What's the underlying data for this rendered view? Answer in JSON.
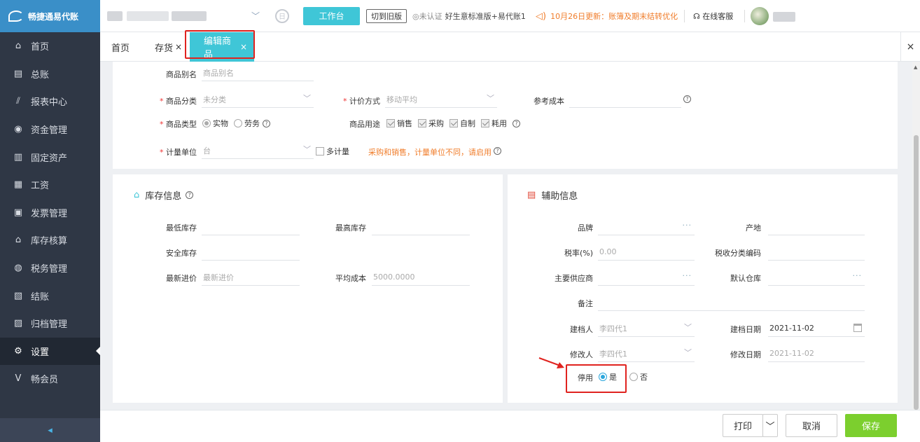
{
  "app": {
    "logo_text": "畅捷通易代账",
    "account_name_blur": ""
  },
  "sidebar": {
    "items": [
      {
        "label": "首页",
        "icon": "⌂"
      },
      {
        "label": "总账",
        "icon": "▤"
      },
      {
        "label": "报表中心",
        "icon": "⫽"
      },
      {
        "label": "资金管理",
        "icon": "◉"
      },
      {
        "label": "固定资产",
        "icon": "▥"
      },
      {
        "label": "工资",
        "icon": "▦"
      },
      {
        "label": "发票管理",
        "icon": "▣"
      },
      {
        "label": "库存核算",
        "icon": "⌂"
      },
      {
        "label": "税务管理",
        "icon": "◍"
      },
      {
        "label": "结账",
        "icon": "▧"
      },
      {
        "label": "归档管理",
        "icon": "▨"
      },
      {
        "label": "设置",
        "icon": "⚙"
      },
      {
        "label": "畅会员",
        "icon": "V"
      }
    ],
    "active_index": 11,
    "collapse_icon": "◂"
  },
  "topbar": {
    "workbench": "工作台",
    "switch_old": "切到旧版",
    "cert": "◎未认证",
    "plan": "好生意标准版+易代账1",
    "notice": "10月26日更新：账簿及期末结转优化",
    "service": "在线客服"
  },
  "tabs": [
    {
      "label": "首页",
      "closable": false
    },
    {
      "label": "存货",
      "closable": true
    },
    {
      "label": "编辑商品",
      "closable": true,
      "active": true
    }
  ],
  "tab_close": "×",
  "basic": {
    "alias_label": "商品别名",
    "alias_placeholder": "商品别名",
    "category_label": "商品分类",
    "category_value": "未分类",
    "pricing_label": "计价方式",
    "pricing_value": "移动平均",
    "ref_cost_label": "参考成本",
    "type_label": "商品类型",
    "type_options": [
      "实物",
      "劳务"
    ],
    "usage_label": "商品用途",
    "usage_options": [
      "销售",
      "采购",
      "自制",
      "耗用"
    ],
    "unit_label": "计量单位",
    "unit_value": "台",
    "multi_unit": "多计量",
    "unit_hint": "采购和销售，计量单位不同，请启用"
  },
  "inventory": {
    "title": "库存信息",
    "min_label": "最低库存",
    "max_label": "最高库存",
    "safe_label": "安全库存",
    "last_price_label": "最新进价",
    "last_price_placeholder": "最新进价",
    "avg_cost_label": "平均成本",
    "avg_cost_value": "5000.0000"
  },
  "aux": {
    "title": "辅助信息",
    "brand_label": "品牌",
    "origin_label": "产地",
    "tax_label": "税率(%)",
    "tax_value": "0.00",
    "tax_code_label": "税收分类编码",
    "supplier_label": "主要供应商",
    "warehouse_label": "默认仓库",
    "remark_label": "备注",
    "creator_label": "建档人",
    "creator_value": "李四代1",
    "create_date_label": "建档日期",
    "create_date_value": "2021-11-02",
    "modifier_label": "修改人",
    "modifier_value": "李四代1",
    "modify_date_label": "修改日期",
    "modify_date_value": "2021-11-02",
    "disable_label": "停用",
    "disable_yes": "是",
    "disable_no": "否",
    "disable_selected": "是"
  },
  "footer": {
    "print": "打印",
    "cancel": "取消",
    "save": "保存"
  },
  "colors": {
    "accent": "#3fc6d7",
    "save": "#7ccf2e",
    "highlight": "#e0231f",
    "warning": "#f07d2b"
  }
}
